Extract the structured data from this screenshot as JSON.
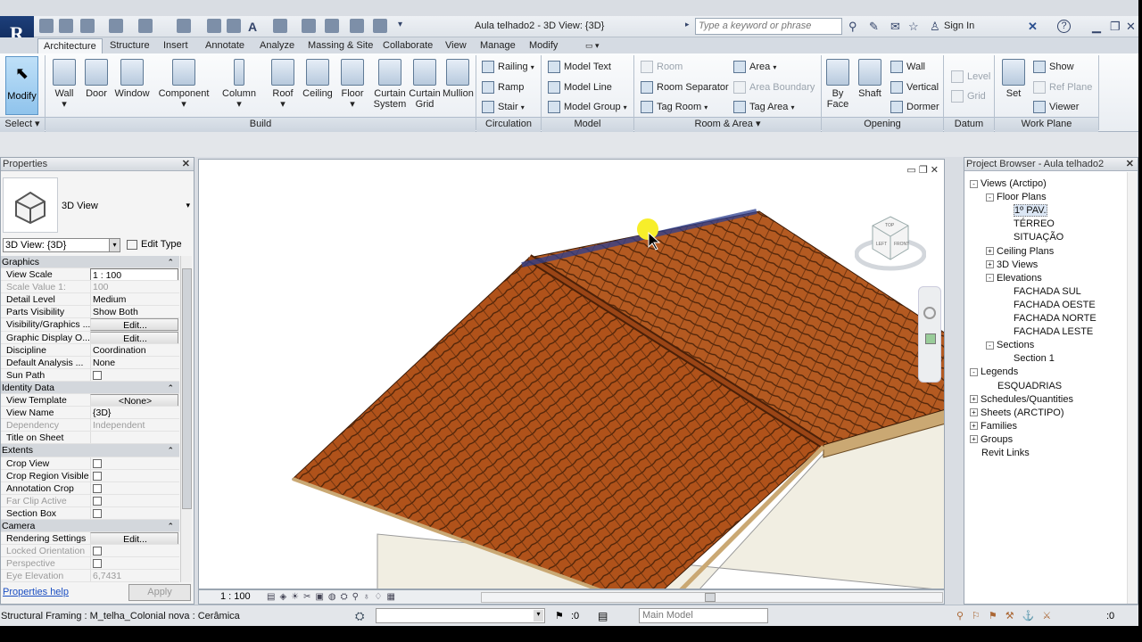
{
  "title_bar": {
    "doc_title": "Aula telhado2 - 3D View: {3D}",
    "search_placeholder": "Type a keyword or phrase",
    "sign_in": "Sign In",
    "help": "?"
  },
  "tabs": [
    "Architecture",
    "Structure",
    "Insert",
    "Annotate",
    "Analyze",
    "Massing & Site",
    "Collaborate",
    "View",
    "Manage",
    "Modify"
  ],
  "ribbon": {
    "select": {
      "modify": "Modify",
      "label": "Select"
    },
    "build": {
      "label": "Build",
      "items": [
        "Wall",
        "Door",
        "Window",
        "Component",
        "Column",
        "Roof",
        "Ceiling",
        "Floor",
        "Curtain System",
        "Curtain Grid",
        "Mullion"
      ]
    },
    "circulation": {
      "label": "Circulation",
      "items": [
        "Railing",
        "Ramp",
        "Stair"
      ]
    },
    "model": {
      "label": "Model",
      "items": [
        "Model Text",
        "Model Line",
        "Model Group"
      ]
    },
    "room_area": {
      "label": "Room & Area",
      "room": "Room",
      "room_separator": "Room Separator",
      "tag_room": "Tag Room",
      "area": "Area",
      "area_boundary": "Area Boundary",
      "tag_area": "Tag Area"
    },
    "opening": {
      "label": "Opening",
      "by_face": "By Face",
      "shaft": "Shaft",
      "wall": "Wall",
      "vertical": "Vertical",
      "dormer": "Dormer"
    },
    "datum": {
      "label": "Datum",
      "level": "Level",
      "grid": "Grid"
    },
    "work_plane": {
      "label": "Work Plane",
      "set": "Set",
      "show": "Show",
      "ref_plane": "Ref Plane",
      "viewer": "Viewer"
    }
  },
  "properties": {
    "header": "Properties",
    "type_name": "3D View",
    "view_selector": "3D View: {3D}",
    "edit_type": "Edit Type",
    "rows": [
      {
        "cat": true,
        "k": "Graphics"
      },
      {
        "k": "View Scale",
        "v": "1 : 100",
        "input": true
      },
      {
        "k": "Scale Value    1:",
        "v": "100",
        "dis": true
      },
      {
        "k": "Detail Level",
        "v": "Medium"
      },
      {
        "k": "Parts Visibility",
        "v": "Show Both"
      },
      {
        "k": "Visibility/Graphics ...",
        "v": "Edit...",
        "btn": true
      },
      {
        "k": "Graphic Display O...",
        "v": "Edit...",
        "btn": true
      },
      {
        "k": "Discipline",
        "v": "Coordination"
      },
      {
        "k": "Default Analysis ...",
        "v": "None"
      },
      {
        "k": "Sun Path",
        "chk": true
      },
      {
        "cat": true,
        "k": "Identity Data"
      },
      {
        "k": "View Template",
        "v": "<None>",
        "btn": true
      },
      {
        "k": "View Name",
        "v": "{3D}"
      },
      {
        "k": "Dependency",
        "v": "Independent",
        "dis": true
      },
      {
        "k": "Title on Sheet",
        "v": ""
      },
      {
        "cat": true,
        "k": "Extents"
      },
      {
        "k": "Crop View",
        "chk": true
      },
      {
        "k": "Crop Region Visible",
        "chk": true
      },
      {
        "k": "Annotation Crop",
        "chk": true
      },
      {
        "k": "Far Clip Active",
        "chk": true,
        "dis": true
      },
      {
        "k": "Section Box",
        "chk": true
      },
      {
        "cat": true,
        "k": "Camera"
      },
      {
        "k": "Rendering Settings",
        "v": "Edit...",
        "btn": true
      },
      {
        "k": "Locked Orientation",
        "chk": true,
        "dis": true
      },
      {
        "k": "Perspective",
        "chk": true,
        "dis": true
      },
      {
        "k": "Eye Elevation",
        "v": "6,7431",
        "dis": true
      }
    ],
    "help_link": "Properties help",
    "apply": "Apply"
  },
  "viewport": {
    "scale": "1 : 100",
    "cube_top": "TOP",
    "cube_left": "LEFT",
    "cube_front": "FRONT"
  },
  "project_browser": {
    "header": "Project Browser - Aula telhado2",
    "nodes": [
      {
        "t": "Views (Arctipo)",
        "lvl": 0,
        "exp": "-"
      },
      {
        "t": "Floor Plans",
        "lvl": 1,
        "exp": "-"
      },
      {
        "t": "1º PAV.",
        "lvl": 2,
        "sel": true
      },
      {
        "t": "TÉRREO",
        "lvl": 2
      },
      {
        "t": "SITUAÇÃO",
        "lvl": 2
      },
      {
        "t": "Ceiling Plans",
        "lvl": 1,
        "exp": "+"
      },
      {
        "t": "3D Views",
        "lvl": 1,
        "exp": "+"
      },
      {
        "t": "Elevations",
        "lvl": 1,
        "exp": "-"
      },
      {
        "t": "FACHADA SUL",
        "lvl": 2
      },
      {
        "t": "FACHADA OESTE",
        "lvl": 2
      },
      {
        "t": "FACHADA NORTE",
        "lvl": 2
      },
      {
        "t": "FACHADA LESTE",
        "lvl": 2
      },
      {
        "t": "Sections",
        "lvl": 1,
        "exp": "-"
      },
      {
        "t": "Section 1",
        "lvl": 2
      },
      {
        "t": "Legends",
        "lvl": 0,
        "exp": "-"
      },
      {
        "t": "ESQUADRIAS",
        "lvl": 1
      },
      {
        "t": "Schedules/Quantities",
        "lvl": 0,
        "exp": "+"
      },
      {
        "t": "Sheets (ARCTIPO)",
        "lvl": 0,
        "exp": "+"
      },
      {
        "t": "Families",
        "lvl": 0,
        "exp": "+"
      },
      {
        "t": "Groups",
        "lvl": 0,
        "exp": "+"
      },
      {
        "t": "Revit Links",
        "lvl": 0
      }
    ]
  },
  "status_bar": {
    "text": "Structural Framing : M_telha_Colonial nova : Cerâmica",
    "zero1": ":0",
    "model": "Main Model",
    "zero2": ":0"
  },
  "colors": {
    "tile": "#b1531c",
    "tile_dark": "#5a2a0e",
    "accent": "#5d96c8"
  }
}
